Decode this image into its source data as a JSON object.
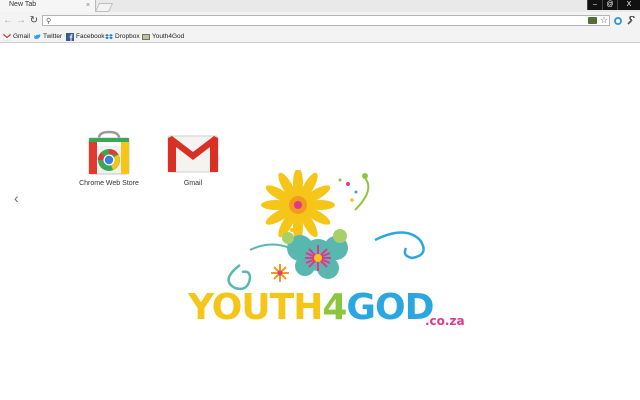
{
  "tab": {
    "title": "New Tab",
    "close": "×"
  },
  "window_controls": {
    "minimize": "–",
    "restore": "@",
    "close": "X"
  },
  "toolbar": {
    "back": "←",
    "forward": "→",
    "reload": "↻",
    "search_glyph": "⚲",
    "star": "☆",
    "url_value": ""
  },
  "bookmarks": [
    {
      "label": "Gmail",
      "icon": "gmail-icon"
    },
    {
      "label": "Twitter",
      "icon": "twitter-icon"
    },
    {
      "label": "Facebook",
      "icon": "facebook-icon"
    },
    {
      "label": "Dropbox",
      "icon": "dropbox-icon"
    },
    {
      "label": "Youth4God",
      "icon": "youth4god-icon"
    }
  ],
  "apps": [
    {
      "label": "Chrome Web Store",
      "icon": "chrome-web-store-icon"
    },
    {
      "label": "Gmail",
      "icon": "gmail-app-icon"
    }
  ],
  "nav": {
    "prev": "‹"
  },
  "logo": {
    "letters": [
      {
        "ch": "Y",
        "color": "#f5c518"
      },
      {
        "ch": "O",
        "color": "#f5c518"
      },
      {
        "ch": "U",
        "color": "#f5c518"
      },
      {
        "ch": "T",
        "color": "#f5c518"
      },
      {
        "ch": "H",
        "color": "#f5c518"
      },
      {
        "ch": "4",
        "color": "#8cc63f"
      },
      {
        "ch": "G",
        "color": "#2aa7e0"
      },
      {
        "ch": "O",
        "color": "#2aa7e0"
      },
      {
        "ch": "D",
        "color": "#2aa7e0"
      }
    ],
    "suffix": ".co.za"
  },
  "colors": {
    "yellow": "#f5c518",
    "green": "#8cc63f",
    "blue": "#2aa7e0",
    "pink": "#e2388a",
    "orange": "#f39a1e"
  }
}
